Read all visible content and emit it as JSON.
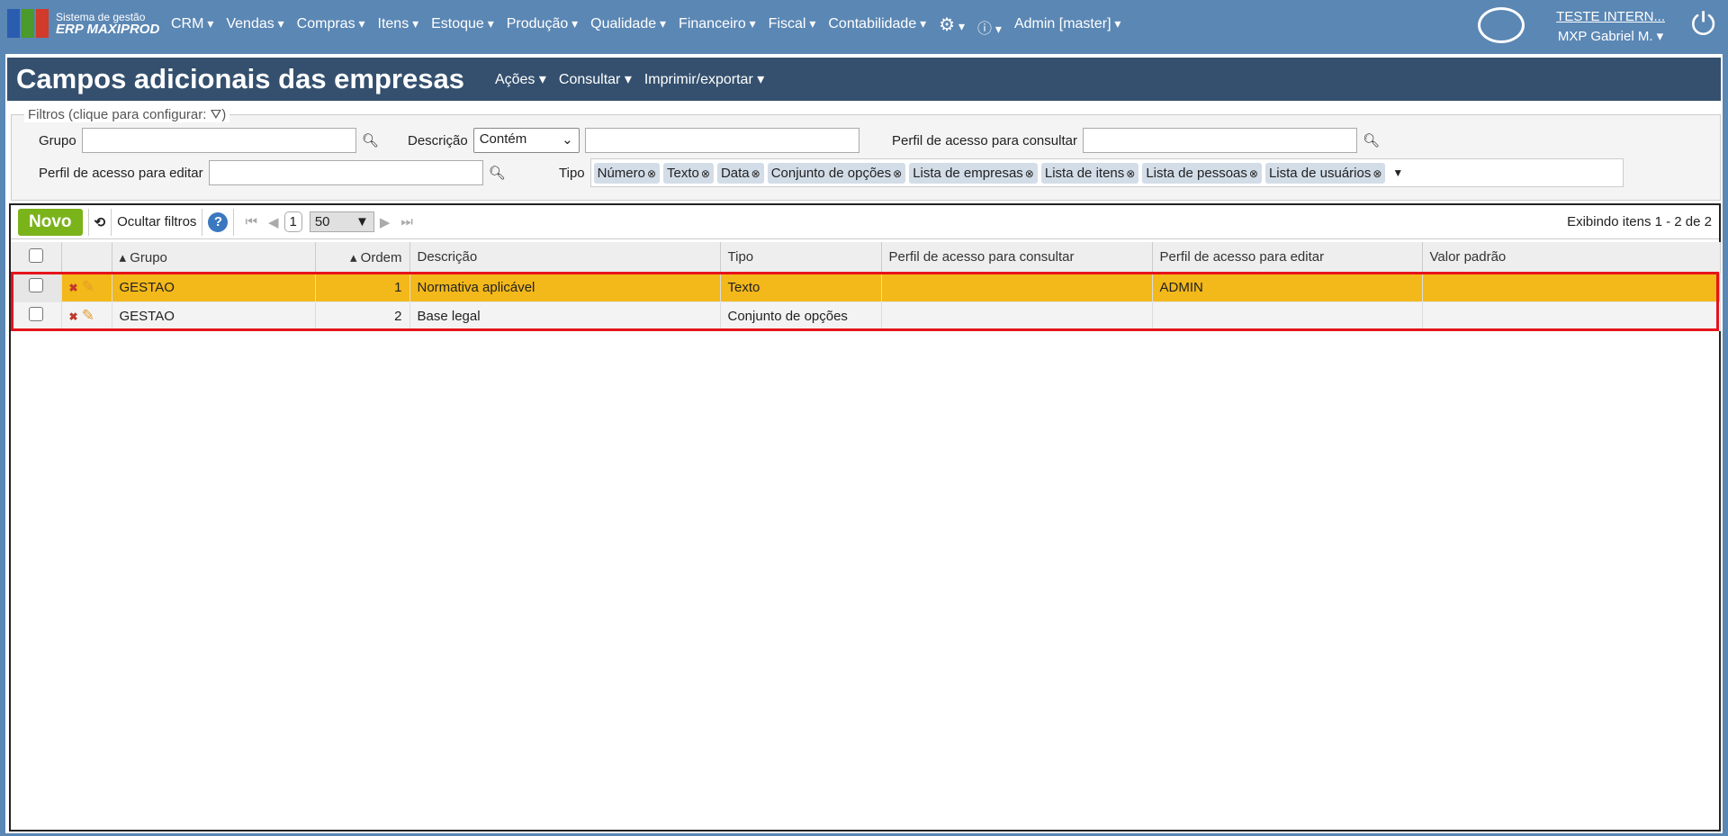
{
  "app": {
    "logo_line1": "Sistema de gestão",
    "logo_line2": "ERP MAXIPROD"
  },
  "menu": [
    "CRM",
    "Vendas",
    "Compras",
    "Itens",
    "Estoque",
    "Produção",
    "Qualidade",
    "Financeiro",
    "Fiscal",
    "Contabilidade"
  ],
  "user_menu": "Admin [master]",
  "company": "TESTE INTERN...",
  "user": "MXP Gabriel M.",
  "page": {
    "title": "Campos adicionais das empresas",
    "actions": [
      "Ações",
      "Consultar",
      "Imprimir/exportar"
    ]
  },
  "filters": {
    "legend": "Filtros (clique para configurar:",
    "legend_end": ")",
    "grupo_label": "Grupo",
    "grupo_value": "",
    "descricao_label": "Descrição",
    "descricao_op": "Contém",
    "descricao_value": "",
    "perfil_consultar_label": "Perfil de acesso para consultar",
    "perfil_editar_label": "Perfil de acesso para editar",
    "tipo_label": "Tipo",
    "tipo_tags": [
      "Número",
      "Texto",
      "Data",
      "Conjunto de opções",
      "Lista de empresas",
      "Lista de itens",
      "Lista de pessoas",
      "Lista de usuários"
    ]
  },
  "toolbar": {
    "novo": "Novo",
    "ocultar": "Ocultar filtros",
    "help": "?",
    "page": "1",
    "page_size": "50",
    "count": "Exibindo itens 1 - 2 de 2"
  },
  "columns": [
    "Grupo",
    "Ordem",
    "Descrição",
    "Tipo",
    "Perfil de acesso para consultar",
    "Perfil de acesso para editar",
    "Valor padrão"
  ],
  "rows": [
    {
      "grupo": "GESTAO",
      "ordem": "1",
      "descricao": "Normativa aplicável",
      "tipo": "Texto",
      "perfil_consultar": "",
      "perfil_editar": "ADMIN",
      "valor": ""
    },
    {
      "grupo": "GESTAO",
      "ordem": "2",
      "descricao": "Base legal",
      "tipo": "Conjunto de opções",
      "perfil_consultar": "",
      "perfil_editar": "",
      "valor": ""
    }
  ]
}
